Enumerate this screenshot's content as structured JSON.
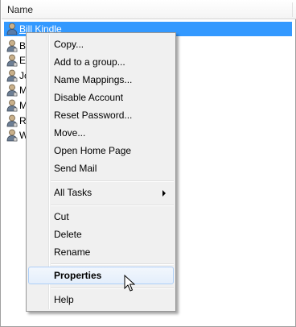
{
  "list": {
    "column_header": "Name",
    "rows": [
      {
        "name": "Bill Kindle",
        "selected": true
      },
      {
        "name": "B"
      },
      {
        "name": "E"
      },
      {
        "name": "Jo"
      },
      {
        "name": "M"
      },
      {
        "name": "M"
      },
      {
        "name": "R"
      },
      {
        "name": "W"
      }
    ]
  },
  "context_menu": {
    "items": {
      "copy": "Copy...",
      "add_to_group": "Add to a group...",
      "name_mappings": "Name Mappings...",
      "disable_account": "Disable Account",
      "reset_password": "Reset Password...",
      "move": "Move...",
      "open_home_page": "Open Home Page",
      "send_mail": "Send Mail",
      "all_tasks": "All Tasks",
      "cut": "Cut",
      "delete": "Delete",
      "rename": "Rename",
      "properties": "Properties",
      "help": "Help"
    }
  },
  "colors": {
    "selection": "#3399ff",
    "menu_background": "#f0f0f0",
    "menu_hover_border": "#aecff7"
  },
  "icons": {
    "user": "user-icon",
    "submenu": "chevron-right-icon",
    "cursor": "mouse-pointer-icon"
  }
}
